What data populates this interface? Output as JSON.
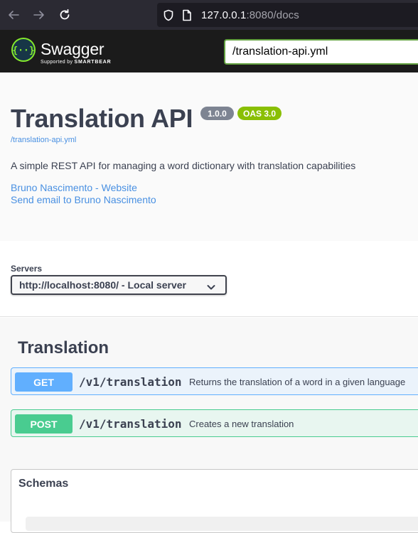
{
  "browser": {
    "url_host": "127.0.0.1",
    "url_rest": ":8080/docs"
  },
  "topbar": {
    "brand": "Swagger",
    "tagline_prefix": "Supported by ",
    "tagline_brand": "SMARTBEAR",
    "spec_url_value": "/translation-api.yml"
  },
  "info": {
    "title": "Translation API",
    "version": "1.0.0",
    "oas_version": "OAS 3.0",
    "spec_link": "/translation-api.yml",
    "description": "A simple REST API for managing a word dictionary with translation capabilities",
    "contact_website": "Bruno Nascimento - Website",
    "contact_email": "Send email to Bruno Nascimento"
  },
  "servers": {
    "label": "Servers",
    "selected": "http://localhost:8080/ - Local server"
  },
  "tag": {
    "name": "Translation",
    "operations": [
      {
        "method": "GET",
        "path": "/v1/translation",
        "summary": "Returns the translation of a word in a given language"
      },
      {
        "method": "POST",
        "path": "/v1/translation",
        "summary": "Creates a new translation"
      }
    ]
  },
  "schemas": {
    "title": "Schemas"
  },
  "colors": {
    "get": "#61affe",
    "post": "#49cc90",
    "link": "#4990e2",
    "oas_badge": "#89bf04"
  }
}
